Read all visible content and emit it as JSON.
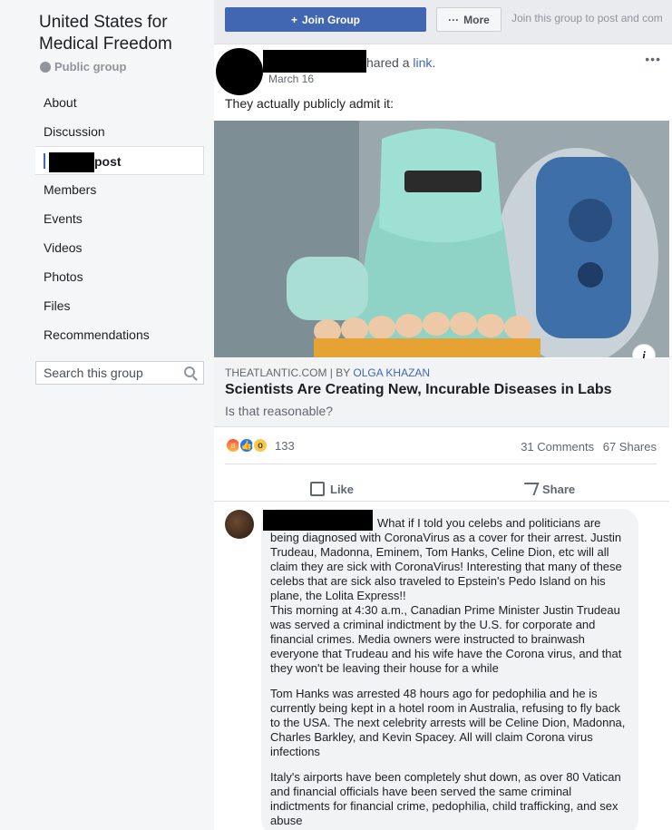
{
  "group": {
    "title": "United States for Medical Freedom",
    "type": "Public group"
  },
  "nav": [
    {
      "label": "About"
    },
    {
      "label": "Discussion"
    },
    {
      "label": "post"
    },
    {
      "label": "Members"
    },
    {
      "label": "Events"
    },
    {
      "label": "Videos"
    },
    {
      "label": "Photos"
    },
    {
      "label": "Files"
    },
    {
      "label": "Recommendations"
    }
  ],
  "search": {
    "placeholder": "Search this group"
  },
  "topbar": {
    "join_label": "Join Group",
    "more_label": "More",
    "hint": "Join this group to post and com"
  },
  "post": {
    "shared_prefix": "hared a ",
    "shared_link": "link",
    "shared_suffix": ".",
    "date": "March 16",
    "text": "They actually publicly admit it:",
    "link": {
      "source": "THEATLANTIC.COM",
      "by": " | BY ",
      "author": "OLGA KHAZAN",
      "title": "Scientists Are Creating New, Incurable Diseases in Labs",
      "description": "Is that reasonable?"
    },
    "reaction_count": "133",
    "comments_count": "31 Comments",
    "shares_count": "67 Shares",
    "like_label": "Like",
    "share_label": "Share"
  },
  "comment": {
    "p1": "What if I told you celebs and politicians are being diagnosed with CoronaVirus as a cover for their arrest. Justin Trudeau, Madonna, Eminem, Tom Hanks, Celine Dion, etc will all claim they are sick with CoronaVirus! Interesting that many of these celebs that are sick also traveled to Epstein's Pedo Island on his plane, the Lolita Express!!",
    "p1b": "This morning at 4:30 a.m., Canadian Prime Minister Justin Trudeau was served a criminal indictment by the U.S. for corporate and financial crimes. Media owners were instructed to brainwash everyone that Trudeau and his wife have the Corona virus, and that they won't be leaving their house for a while",
    "p2": "Tom Hanks was arrested 48 hours ago for pedophilia and he is currently being kept in a hotel room in Australia, refusing to fly back to the USA. The next celebrity arrests will be Celine Dion, Madonna, Charles Barkley, and Kevin Spacey. All will claim Corona virus infections",
    "p3": "Italy's airports have been completely shut down, as over 80 Vatican and financial officials have been served the same criminal indictments for financial crime, pedophilia, child trafficking, and sex abuse"
  }
}
